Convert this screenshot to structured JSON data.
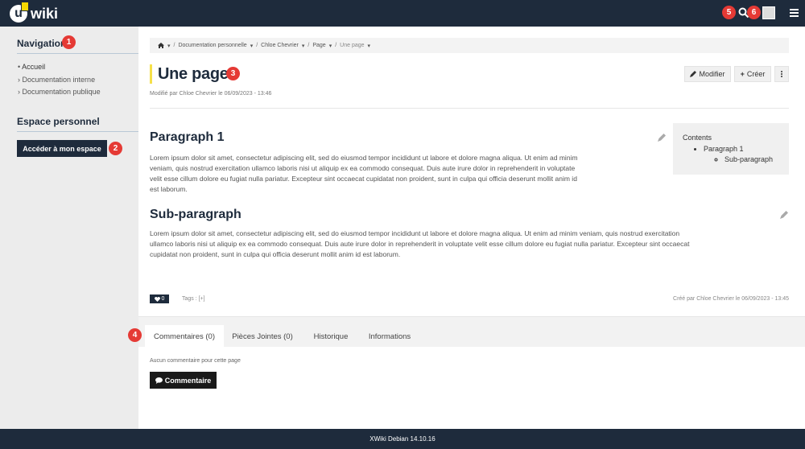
{
  "header": {
    "logo_text": "wiki",
    "logo_mark": "u",
    "icons": [
      "search-icon",
      "user-avatar",
      "hamburger-menu-icon"
    ],
    "badges": {
      "search": "5",
      "avatar": "6"
    }
  },
  "sidebar": {
    "navigation_title": "Navigation",
    "navigation_badge": "1",
    "items": [
      {
        "label": "Accueil",
        "marker": "•"
      },
      {
        "label": "Documentation interne",
        "marker": "›"
      },
      {
        "label": "Documentation publique",
        "marker": "›"
      }
    ],
    "personal_title": "Espace personnel",
    "space_button": "Accéder à mon espace",
    "space_badge": "2"
  },
  "breadcrumb": {
    "home_icon": "home-icon",
    "items": [
      "Documentation personnelle",
      "Chloe Chevrier",
      "Page",
      "Une page"
    ],
    "separator": "/",
    "caret": "▾"
  },
  "page": {
    "title": "Une page",
    "title_badge": "3",
    "modified": "Modifié par Chloe Chevrier le 06/09/2023 - 13:46",
    "edit_button": "Modifier",
    "create_button": "Créer",
    "more_icon": "vertical-ellipsis-icon"
  },
  "content": {
    "sections": [
      {
        "heading": "Paragraph 1",
        "lines": [
          "Lorem ipsum dolor sit amet, consectetur adipiscing elit, sed do eiusmod tempor incididunt ut labore et dolore magna aliqua. Ut enim ad minim",
          "veniam, quis nostrud exercitation ullamco laboris nisi ut aliquip ex ea commodo consequat. Duis aute irure dolor in reprehenderit in voluptate",
          "velit esse cillum dolore eu fugiat nulla pariatur. Excepteur sint occaecat cupidatat non proident, sunt in culpa qui officia deserunt mollit anim id",
          "est laborum."
        ]
      },
      {
        "heading": "Sub-paragraph",
        "lines": [
          "Lorem ipsum dolor sit amet, consectetur adipiscing elit, sed do eiusmod tempor incididunt ut labore et dolore magna aliqua. Ut enim ad minim veniam, quis nostrud exercitation",
          "ullamco laboris nisi ut aliquip ex ea commodo consequat. Duis aute irure dolor in reprehenderit in voluptate velit esse cillum dolore eu fugiat nulla pariatur. Excepteur sint occaecat",
          "cupidatat non proident, sunt in culpa qui officia deserunt mollit anim id est laborum."
        ]
      }
    ],
    "toc": {
      "title": "Contents",
      "item": "Paragraph 1",
      "subitem": "Sub-paragraph"
    }
  },
  "page_footer": {
    "likes": "0",
    "tags_label": "Tags :",
    "tags_add": "[+]",
    "created": "Créé par Chloe Chevrier le 06/09/2023 - 13:45"
  },
  "tabs": {
    "badge": "4",
    "items": [
      "Commentaires (0)",
      "Pièces Jointes (0)",
      "Historique",
      "Informations"
    ],
    "no_comment": "Aucun commentaire pour cette page",
    "comment_button": "Commentaire"
  },
  "footer": {
    "version": "XWiki Debian 14.10.16"
  },
  "colors": {
    "navy": "#1e2b3c",
    "badge_red": "#e53a35",
    "title_accent": "#f5e04a"
  }
}
